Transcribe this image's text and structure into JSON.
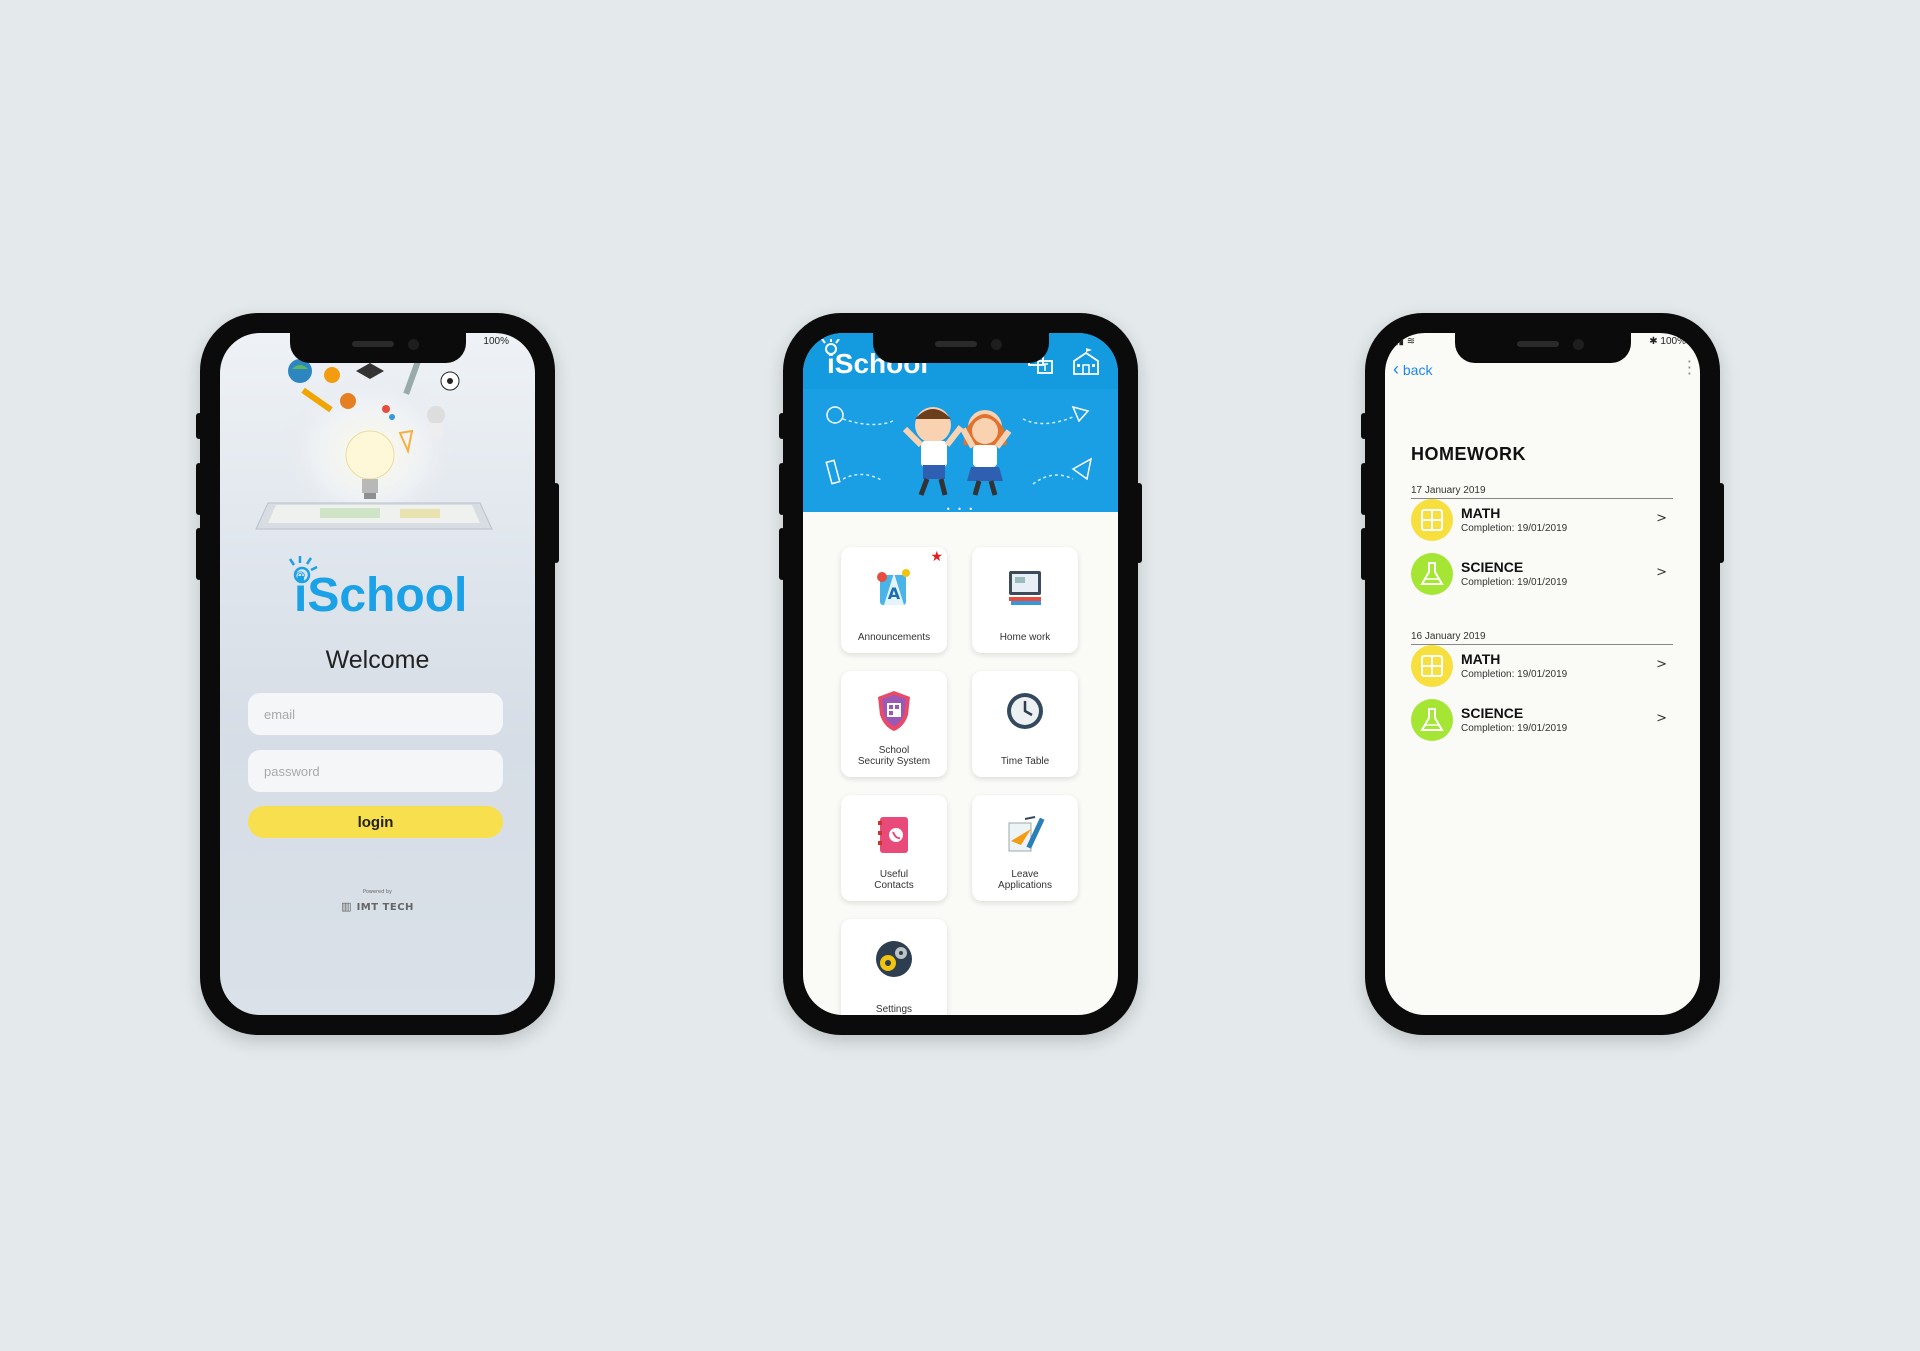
{
  "login_screen": {
    "status_battery": "100%",
    "logo_text": "iSchool",
    "welcome": "Welcome",
    "email_placeholder": "email",
    "password_placeholder": "password",
    "login_label": "login",
    "powered_by": "Powered by",
    "brand": "IMT TECH"
  },
  "dashboard_screen": {
    "logo_text": "iSchool",
    "carousel_dots": "• • •",
    "tiles": [
      {
        "label": "Announcements",
        "badge": "★"
      },
      {
        "label": "Home work"
      },
      {
        "label": "School\nSecurity System"
      },
      {
        "label": "Time Table"
      },
      {
        "label": "Useful\nContacts"
      },
      {
        "label": "Leave\nApplications"
      },
      {
        "label": "Settings"
      }
    ]
  },
  "homework_screen": {
    "status_battery": "100%",
    "back_label": "back",
    "title": "HOMEWORK",
    "groups": [
      {
        "date": "17 January 2019",
        "items": [
          {
            "subject": "MATH",
            "completion": "Completion: 19/01/2019",
            "chevron": ">"
          },
          {
            "subject": "SCIENCE",
            "completion": "Completion: 19/01/2019",
            "chevron": ">"
          }
        ]
      },
      {
        "date": "16 January 2019",
        "items": [
          {
            "subject": "MATH",
            "completion": "Completion: 19/01/2019",
            "chevron": ">"
          },
          {
            "subject": "SCIENCE",
            "completion": "Completion: 19/01/2019",
            "chevron": ">"
          }
        ]
      }
    ],
    "colors": {
      "math": "#f7df3e",
      "science": "#a5e635"
    }
  },
  "colors": {
    "background": "#e4eaec",
    "brand_blue": "#1aa1e6",
    "login_yellow": "#f8df4d"
  }
}
